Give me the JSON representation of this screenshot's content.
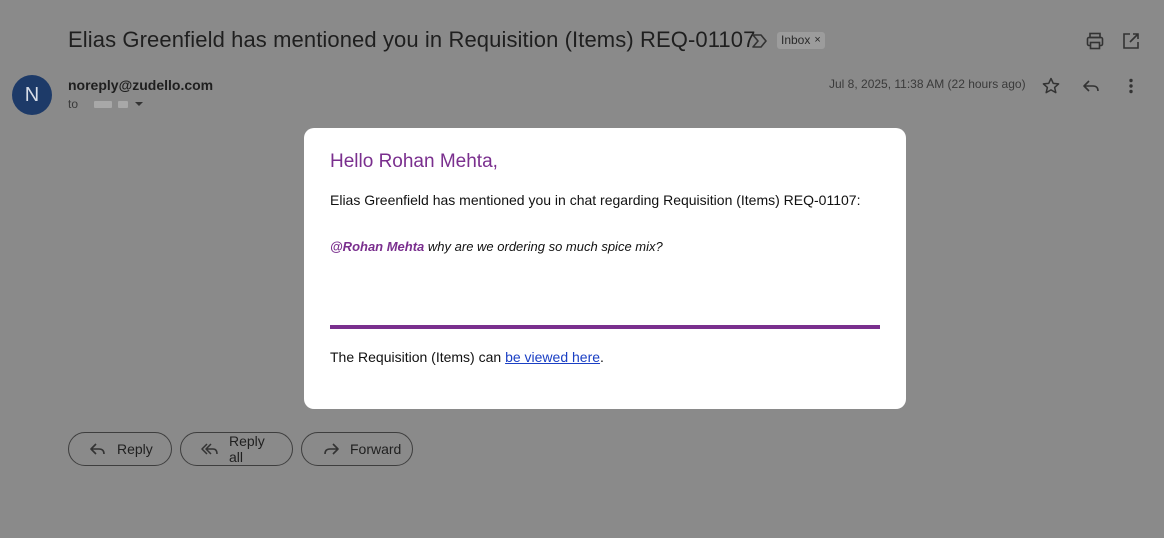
{
  "header": {
    "subject": "Elias Greenfield has mentioned you in Requisition (Items) REQ-01107",
    "label": "Inbox",
    "label_remove": "×",
    "icons": [
      "important-icon",
      "print-icon",
      "open-in-new-window-icon"
    ]
  },
  "sender": {
    "avatar_initial": "N",
    "email": "noreply@zudello.com",
    "to_label": "to",
    "date": "Jul 8, 2025, 11:38 AM (22 hours ago)",
    "icons": [
      "star-icon",
      "reply-icon",
      "more-vert-icon"
    ]
  },
  "email_body": {
    "greeting": "Hello Rohan Mehta,",
    "intro": "Elias Greenfield has mentioned you in chat regarding Requisition (Items) REQ-01107:",
    "mention_name": "@Rohan Mehta",
    "mention_text": " why are we ordering so much spice mix?",
    "footer_prefix": "The Requisition (Items) can ",
    "footer_link": "be viewed here",
    "footer_suffix": ".",
    "accent_color": "#7a2f8e",
    "link_color": "#1a3fc4"
  },
  "actions": {
    "reply": "Reply",
    "reply_all": "Reply all",
    "forward": "Forward"
  }
}
